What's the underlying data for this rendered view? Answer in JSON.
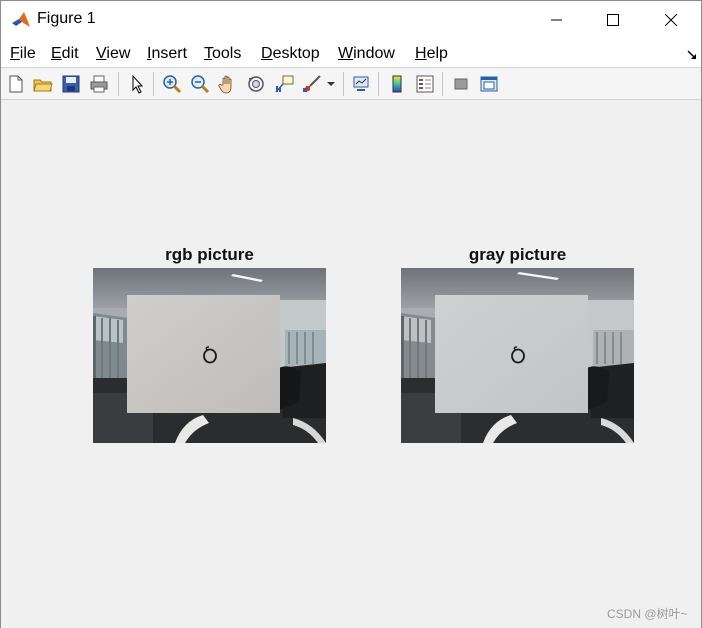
{
  "window": {
    "title": "Figure 1"
  },
  "menu": {
    "items": [
      {
        "accel": "F",
        "rest": "ile"
      },
      {
        "accel": "E",
        "rest": "dit"
      },
      {
        "accel": "V",
        "rest": "iew"
      },
      {
        "accel": "I",
        "rest": "nsert"
      },
      {
        "accel": "T",
        "rest": "ools"
      },
      {
        "accel": "D",
        "rest": "esktop"
      },
      {
        "accel": "W",
        "rest": "indow"
      },
      {
        "accel": "H",
        "rest": "elp"
      }
    ]
  },
  "toolbar": {
    "icons": [
      "new-figure-icon",
      "open-file-icon",
      "save-icon",
      "print-icon",
      "select-arrow-icon",
      "zoom-in-icon",
      "zoom-out-icon",
      "pan-hand-icon",
      "rotate-3d-icon",
      "data-cursor-icon",
      "brush-icon",
      "brush-dropdown-icon",
      "link-plot-icon",
      "colorbar-icon",
      "legend-icon",
      "hide-plot-tools-icon",
      "show-plot-tools-icon"
    ]
  },
  "axes": [
    {
      "title": "rgb picture",
      "mode": "rgb"
    },
    {
      "title": "gray picture",
      "mode": "gray"
    }
  ],
  "watermark": "CSDN @树叶~",
  "colors": {
    "titlebar_bg": "#ffffff",
    "figure_bg": "#f0f0f0",
    "matlab_orange": "#e16a1c",
    "matlab_blue": "#2b5aa6"
  }
}
